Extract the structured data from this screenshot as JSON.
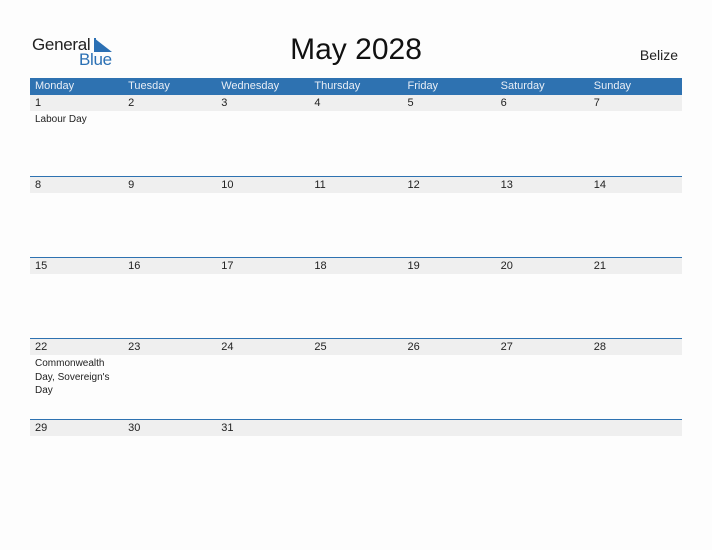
{
  "logo": {
    "general": "General",
    "blue": "Blue"
  },
  "title": "May 2028",
  "country": "Belize",
  "weekdays": [
    "Monday",
    "Tuesday",
    "Wednesday",
    "Thursday",
    "Friday",
    "Saturday",
    "Sunday"
  ],
  "weeks": [
    {
      "days": [
        "1",
        "2",
        "3",
        "4",
        "5",
        "6",
        "7"
      ],
      "events": [
        "Labour Day",
        "",
        "",
        "",
        "",
        "",
        ""
      ]
    },
    {
      "days": [
        "8",
        "9",
        "10",
        "11",
        "12",
        "13",
        "14"
      ],
      "events": [
        "",
        "",
        "",
        "",
        "",
        "",
        ""
      ]
    },
    {
      "days": [
        "15",
        "16",
        "17",
        "18",
        "19",
        "20",
        "21"
      ],
      "events": [
        "",
        "",
        "",
        "",
        "",
        "",
        ""
      ]
    },
    {
      "days": [
        "22",
        "23",
        "24",
        "25",
        "26",
        "27",
        "28"
      ],
      "events": [
        "Commonwealth Day, Sovereign's Day",
        "",
        "",
        "",
        "",
        "",
        ""
      ]
    },
    {
      "days": [
        "29",
        "30",
        "31",
        "",
        "",
        "",
        ""
      ],
      "events": [
        "",
        "",
        "",
        "",
        "",
        "",
        ""
      ]
    }
  ],
  "colors": {
    "accent": "#2e72b1",
    "strip": "#efefef"
  }
}
